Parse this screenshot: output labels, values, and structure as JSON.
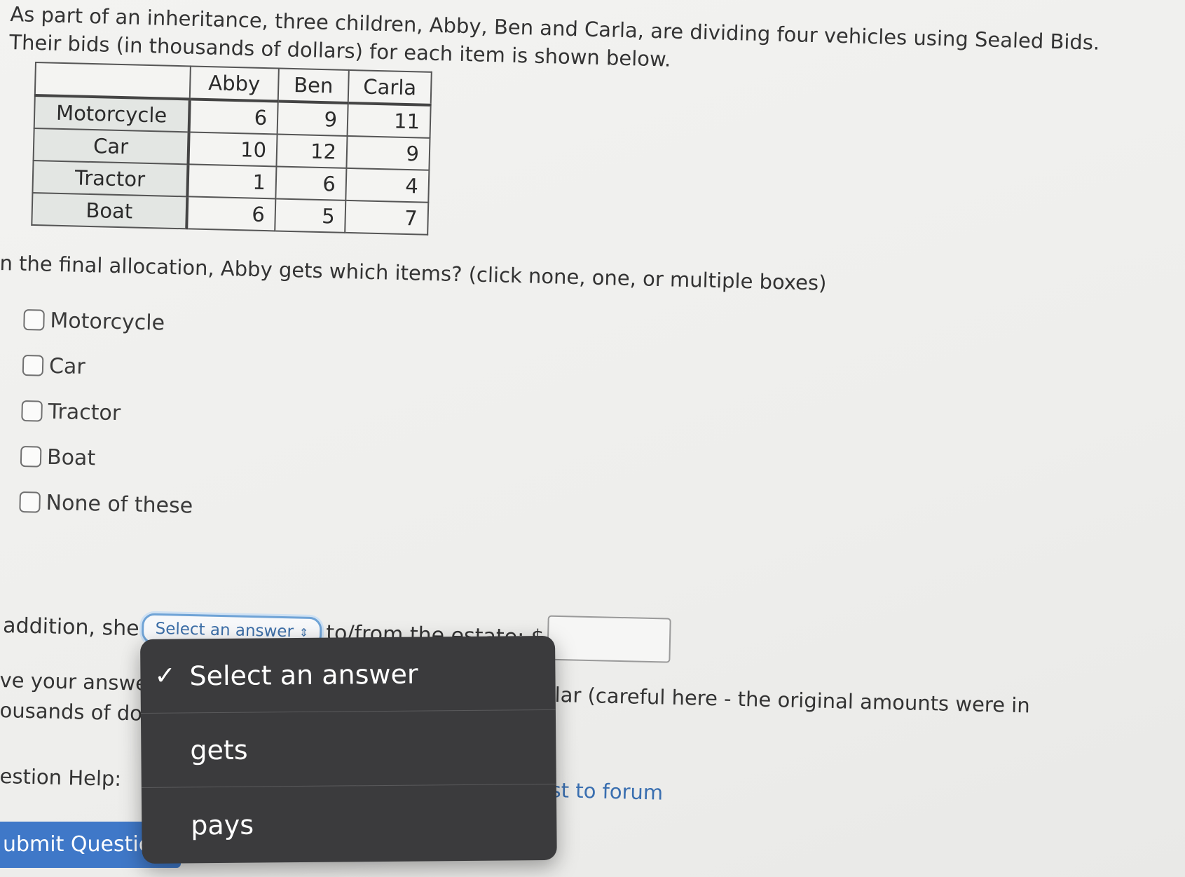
{
  "problem": {
    "intro_line1": "As part of an inheritance, three children, Abby, Ben and Carla, are dividing four vehicles using Sealed Bids.",
    "intro_line2": "Their bids (in thousands of dollars) for each item is shown below."
  },
  "table": {
    "headers": [
      "Abby",
      "Ben",
      "Carla"
    ],
    "rows": [
      {
        "item": "Motorcycle",
        "values": [
          "6",
          "9",
          "11"
        ]
      },
      {
        "item": "Car",
        "values": [
          "10",
          "12",
          "9"
        ]
      },
      {
        "item": "Tractor",
        "values": [
          "1",
          "6",
          "4"
        ]
      },
      {
        "item": "Boat",
        "values": [
          "6",
          "5",
          "7"
        ]
      }
    ]
  },
  "question": {
    "prompt": "n the final allocation, Abby gets which items? (click none, one, or multiple boxes)",
    "options": [
      "Motorcycle",
      "Car",
      "Tractor",
      "Boat",
      "None of these"
    ]
  },
  "addition": {
    "prefix": "addition, she",
    "select_value": "Select an answer",
    "suffix": "to/from the estate: $",
    "input_value": ""
  },
  "partial_text": {
    "answer_left_1": "ve your answe",
    "answer_left_2": "ousands of dol",
    "answer_right": "lar (careful here - the original amounts were in",
    "help_left": "estion Help:",
    "help_right": "st to forum"
  },
  "submit": {
    "label": "ubmit Questic"
  },
  "dropdown": {
    "check_glyph": "✓",
    "items": [
      "Select an answer",
      "gets",
      "pays"
    ]
  }
}
